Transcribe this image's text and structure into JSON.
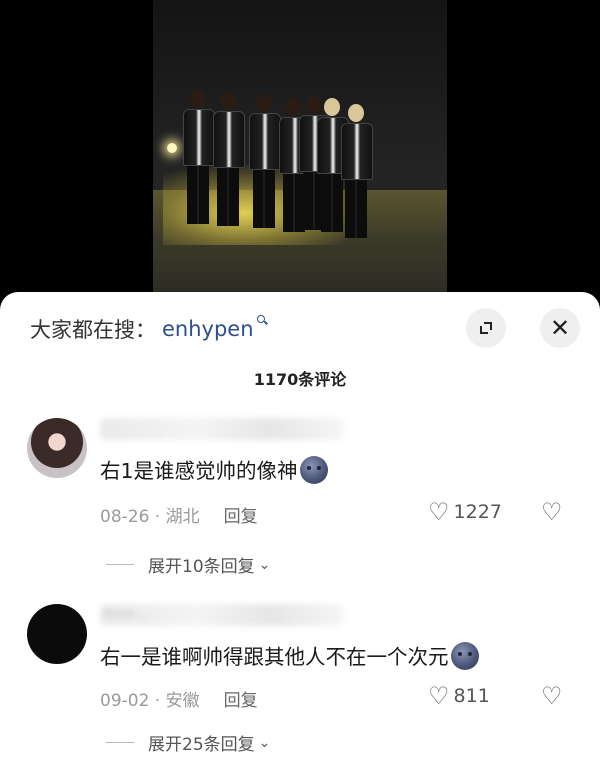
{
  "sheet": {
    "search_prefix": "大家都在搜：",
    "search_term": "enhypen",
    "close_glyph": "✕",
    "comment_count": "1170条评论"
  },
  "comments": [
    {
      "username": "",
      "text": "右1是谁感觉帅的像神",
      "date": "08-26 · 湖北",
      "reply_label": "回复",
      "likes": "1227",
      "expand_label": "展开10条回复"
    },
    {
      "username": "ilove...",
      "text": "右一是谁啊帅得跟其他人不在一个次元",
      "date": "09-02 · 安徽",
      "reply_label": "回复",
      "likes": "811",
      "expand_label": "展开25条回复"
    }
  ],
  "icons": {
    "heart": "♡",
    "broken_heart": "♡",
    "chevron": "⌄"
  }
}
